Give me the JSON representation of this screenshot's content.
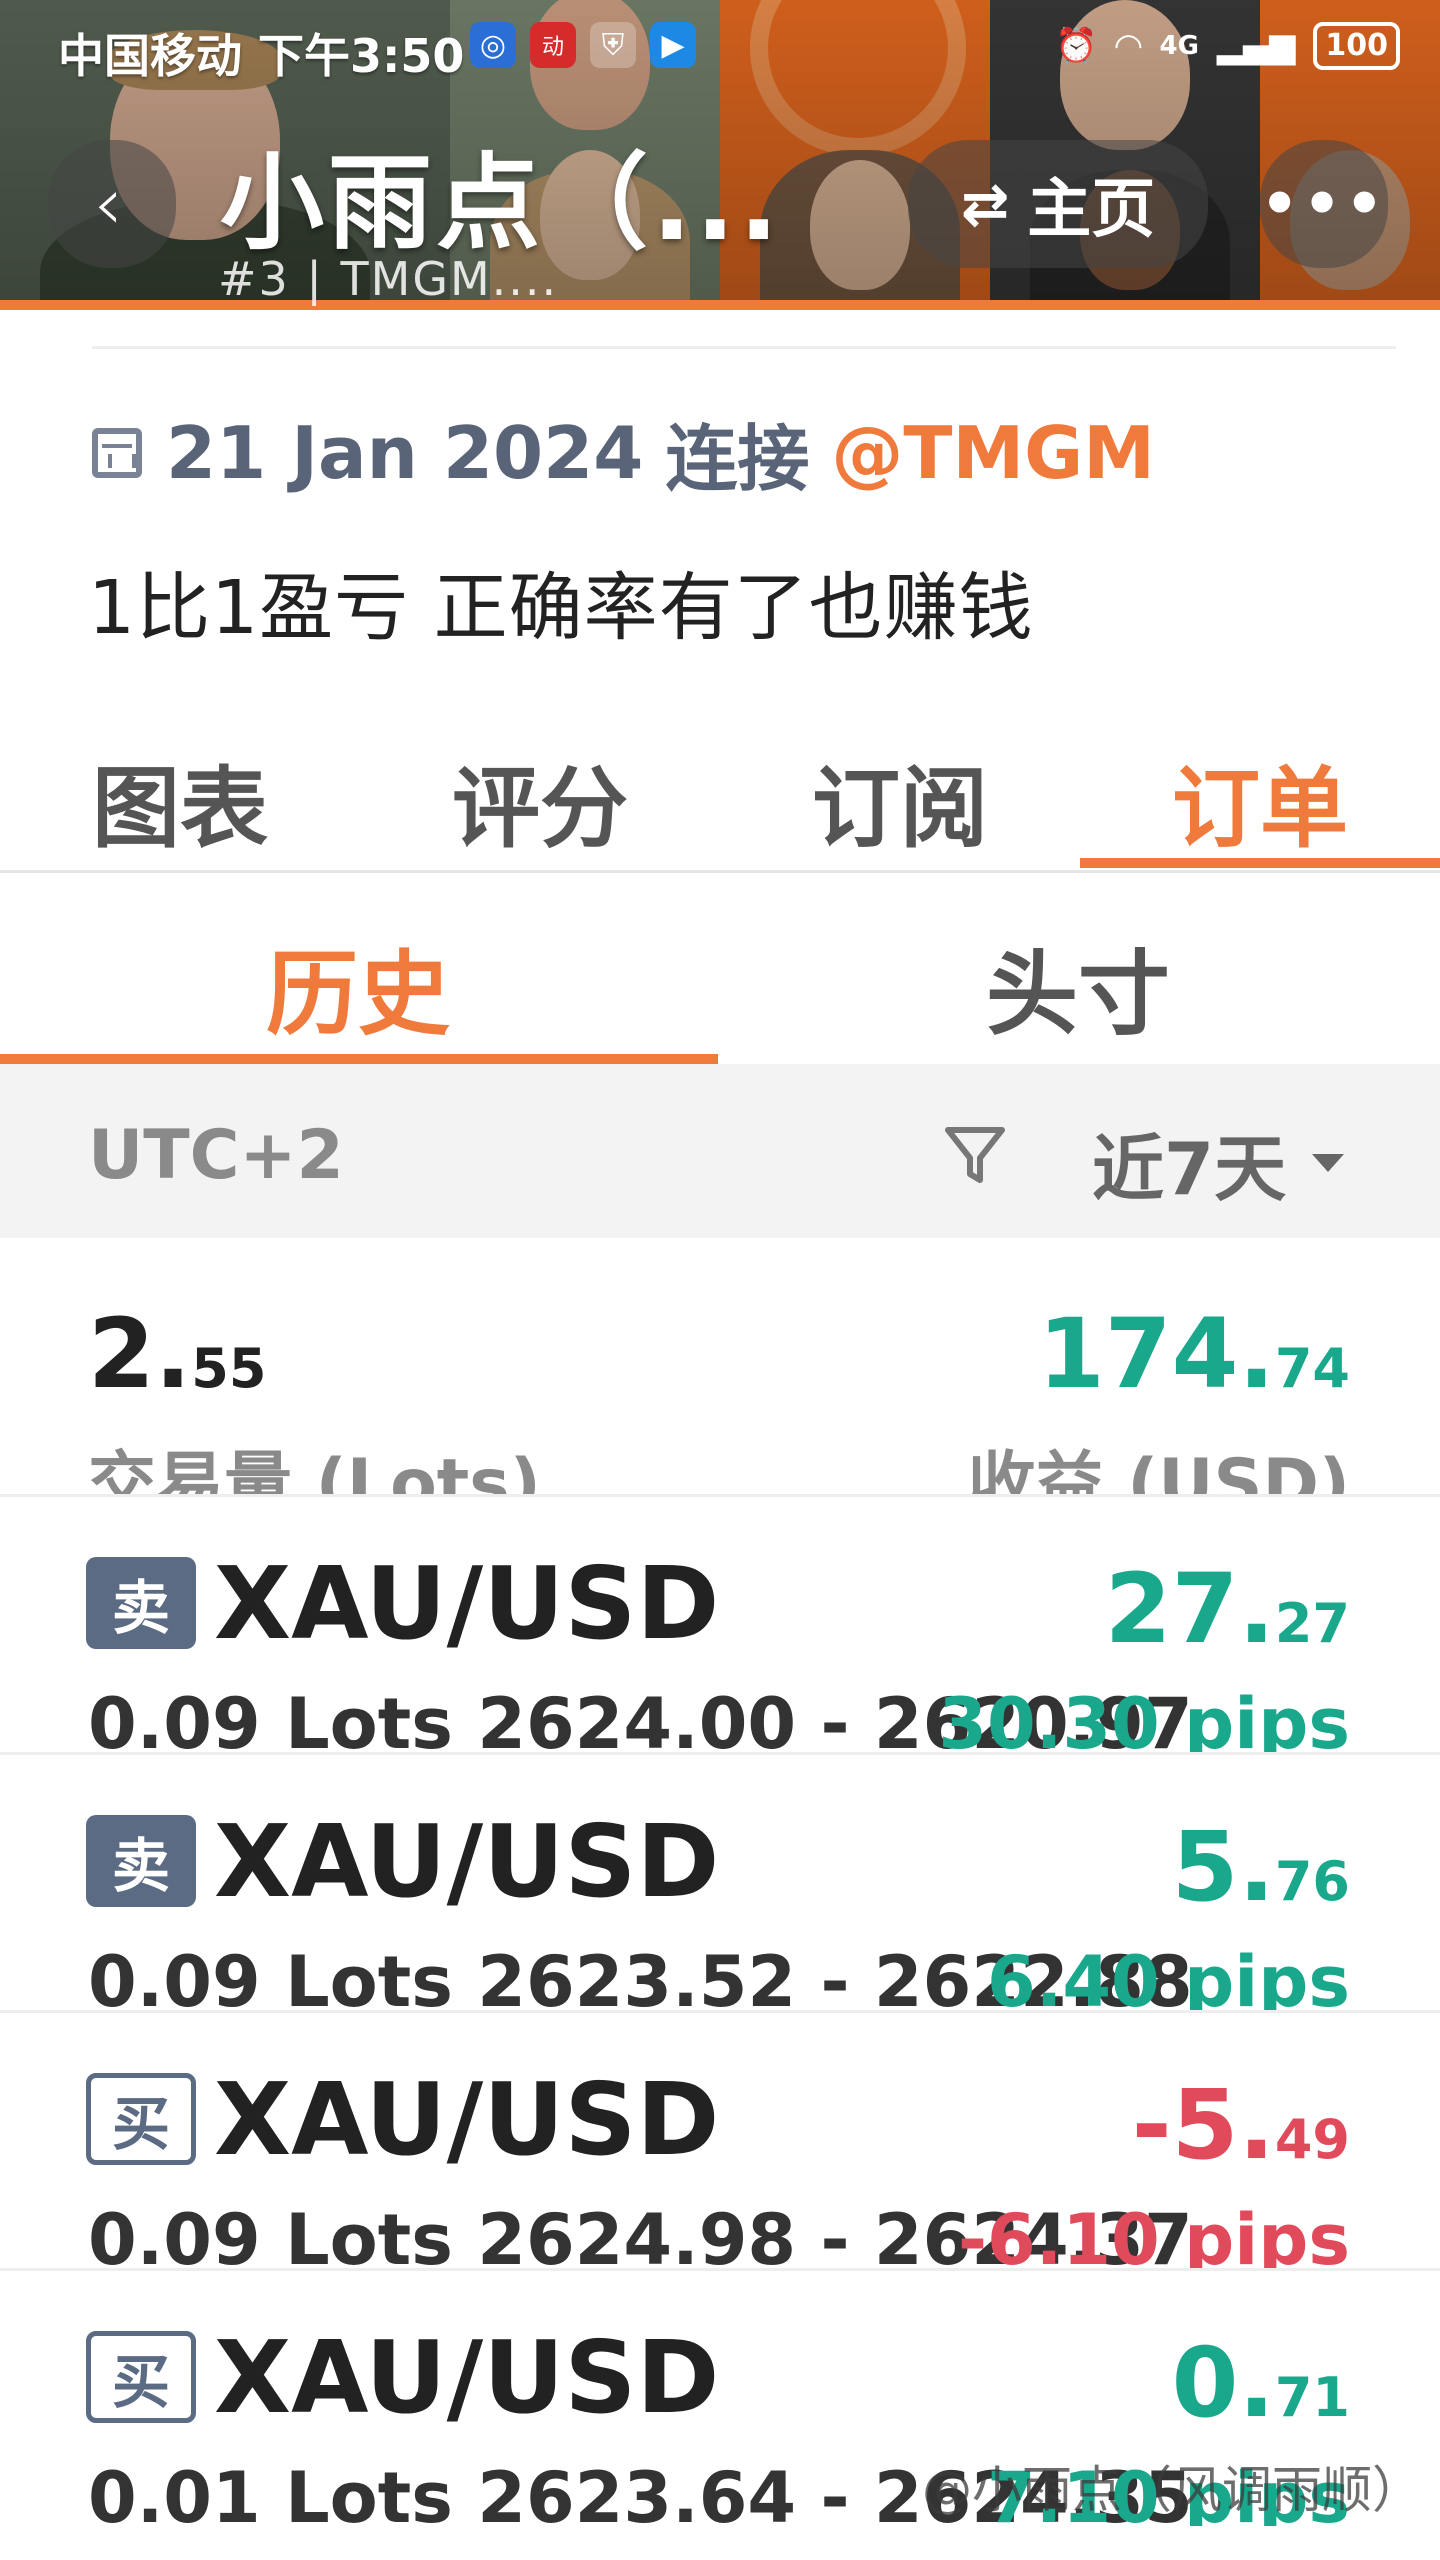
{
  "status_bar": {
    "carrier": "中国移动 下午3:50",
    "network": "4G",
    "battery": "100"
  },
  "header": {
    "back_icon": "chevron-left-icon",
    "title": "小雨点（...",
    "subtitle": "#3 | TMGM....",
    "home_label": "主页",
    "home_icon": "swap-arrows-icon",
    "more_icon": "ellipsis-icon"
  },
  "info": {
    "date": "21 Jan 2024",
    "connect_label": "连接",
    "broker": "@TMGM",
    "description": "1比1盈亏 正确率有了也赚钱"
  },
  "main_tabs": [
    "图表",
    "评分",
    "订阅",
    "订单"
  ],
  "sub_tabs": [
    "历史",
    "头寸"
  ],
  "filter": {
    "timezone": "UTC+2",
    "range": "近7天"
  },
  "summary": {
    "lots_int": "2.",
    "lots_dec": "55",
    "lots_label": "交易量 (Lots)",
    "profit_int": "174.",
    "profit_dec": "74",
    "profit_label": "收益 (USD)"
  },
  "orders": [
    {
      "side": "卖",
      "type": "sell",
      "symbol": "XAU/USD",
      "profit_int": "27.",
      "profit_dec": "27",
      "sign": "pos",
      "detail": "0.09 Lots 2624.00 - 2620.97",
      "pips": "30.30 pips"
    },
    {
      "side": "卖",
      "type": "sell",
      "symbol": "XAU/USD",
      "profit_int": "5.",
      "profit_dec": "76",
      "sign": "pos",
      "detail": "0.09 Lots 2623.52 - 2622.88",
      "pips": "6.40 pips"
    },
    {
      "side": "买",
      "type": "buy",
      "symbol": "XAU/USD",
      "profit_int": "-5.",
      "profit_dec": "49",
      "sign": "neg",
      "detail": "0.09 Lots 2624.98 - 2624.37",
      "pips": "-6.10 pips"
    },
    {
      "side": "买",
      "type": "buy",
      "symbol": "XAU/USD",
      "profit_int": "0.",
      "profit_dec": "71",
      "sign": "pos",
      "detail": "0.01 Lots 2623.64 - 2624.35",
      "pips": "7.10 pips"
    }
  ],
  "watermark": "@小雨点（风调雨顺）",
  "colors": {
    "accent": "#f07a3c",
    "positive": "#1aa88c",
    "negative": "#e04a5b",
    "badge": "#5b6b84"
  }
}
